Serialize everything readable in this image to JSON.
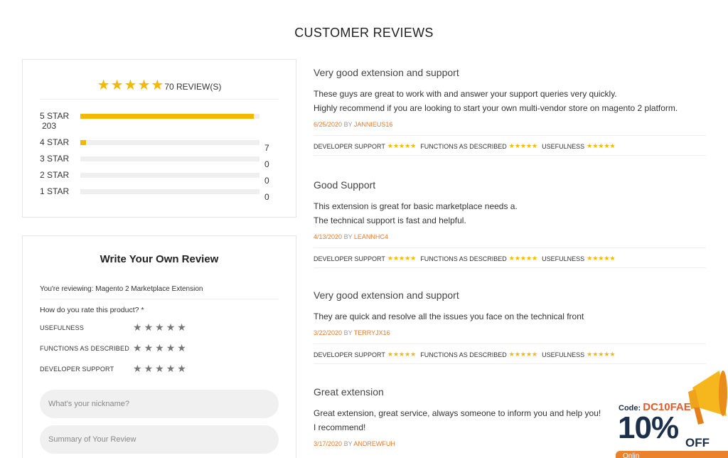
{
  "page": {
    "title": "CUSTOMER REVIEWS"
  },
  "summary": {
    "stars": 5,
    "review_count": "70 REVIEW(S)",
    "bars": [
      {
        "label": "5 STAR",
        "count": "203",
        "fraction": 0.967
      },
      {
        "label": "4 STAR",
        "count": "7",
        "fraction": 0.033
      },
      {
        "label": "3 STAR",
        "count": "0",
        "fraction": 0
      },
      {
        "label": "2 STAR",
        "count": "0",
        "fraction": 0
      },
      {
        "label": "1 STAR",
        "count": "0",
        "fraction": 0
      }
    ]
  },
  "write_review": {
    "title": "Write Your Own Review",
    "reviewing": "You're reviewing: Magento 2 Marketplace Extension",
    "rate_question": "How do you rate this product? *",
    "criteria": [
      {
        "label": "USEFULNESS"
      },
      {
        "label": "FUNCTIONS AS DESCRIBED"
      },
      {
        "label": "DEVELOPER SUPPORT"
      }
    ],
    "nickname_placeholder": "What's your nickname?",
    "summary_placeholder": "Summary of Your Review"
  },
  "reviews": [
    {
      "title": "Very good extension and support",
      "body": [
        "These guys are great to work with and answer your support queries very quickly.",
        "Highly recommend if you are looking to start your own multi-vendor store on magento 2 platform."
      ],
      "date": "6/25/2020",
      "by": "BY",
      "author": "JANNIEUS16",
      "ratings": [
        "DEVELOPER SUPPORT",
        "FUNCTIONS AS DESCRIBED",
        "USEFULNESS"
      ]
    },
    {
      "title": "Good Support",
      "body": [
        "This extension is great for basic marketplace needs a.",
        "The technical support is fast and helpful."
      ],
      "date": "4/13/2020",
      "by": "BY",
      "author": "LEANNHC4",
      "ratings": [
        "DEVELOPER SUPPORT",
        "FUNCTIONS AS DESCRIBED",
        "USEFULNESS"
      ]
    },
    {
      "title": "Very good extension and support",
      "body": [
        "They are quick and resolve all the issues you face on the technical front"
      ],
      "date": "3/22/2020",
      "by": "BY",
      "author": "TERRYJX16",
      "ratings": [
        "DEVELOPER SUPPORT",
        "FUNCTIONS AS DESCRIBED",
        "USEFULNESS"
      ]
    },
    {
      "title": "Great extension",
      "body": [
        "Great extension, great service, always someone to inform you and help you!",
        "I recommend!"
      ],
      "date": "3/17/2020",
      "by": "BY",
      "author": "ANDREWFUH",
      "ratings": []
    }
  ],
  "promo": {
    "code_label": "Code:",
    "code": "DC10FAE",
    "percent": "10%",
    "off": "OFF",
    "bar_text": "Onlin"
  },
  "colors": {
    "star": "#f5b800",
    "accent": "#e37b2f",
    "navy": "#1c2f4a"
  }
}
